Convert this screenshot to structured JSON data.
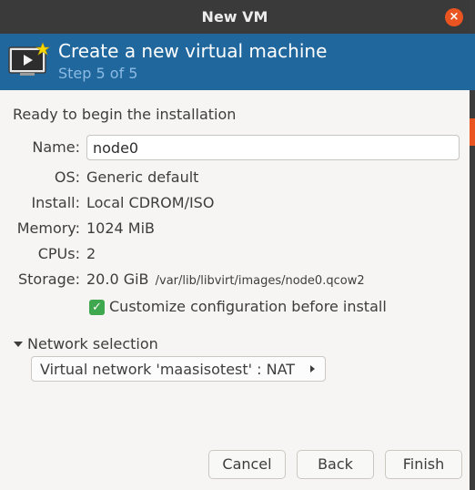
{
  "window": {
    "title": "New VM",
    "close_symbol": "×"
  },
  "header": {
    "title": "Create a new virtual machine",
    "step": "Step 5 of 5"
  },
  "summary": {
    "heading": "Ready to begin the installation",
    "name_label": "Name:",
    "name_value": "node0",
    "os_label": "OS:",
    "os_value": "Generic default",
    "install_label": "Install:",
    "install_value": "Local CDROM/ISO",
    "memory_label": "Memory:",
    "memory_value": "1024 MiB",
    "cpus_label": "CPUs:",
    "cpus_value": "2",
    "storage_label": "Storage:",
    "storage_value": "20.0 GiB",
    "storage_path": "/var/lib/libvirt/images/node0.qcow2"
  },
  "customize": {
    "label": "Customize configuration before install",
    "checked": true
  },
  "network": {
    "expander_label": "Network selection",
    "selected": "Virtual network 'maasisotest' : NAT"
  },
  "buttons": {
    "cancel": "Cancel",
    "back": "Back",
    "finish": "Finish"
  },
  "colors": {
    "banner": "#20679e",
    "step_text": "#8bbbe3",
    "close_button": "#e95420",
    "checkbox": "#3fa84e"
  }
}
